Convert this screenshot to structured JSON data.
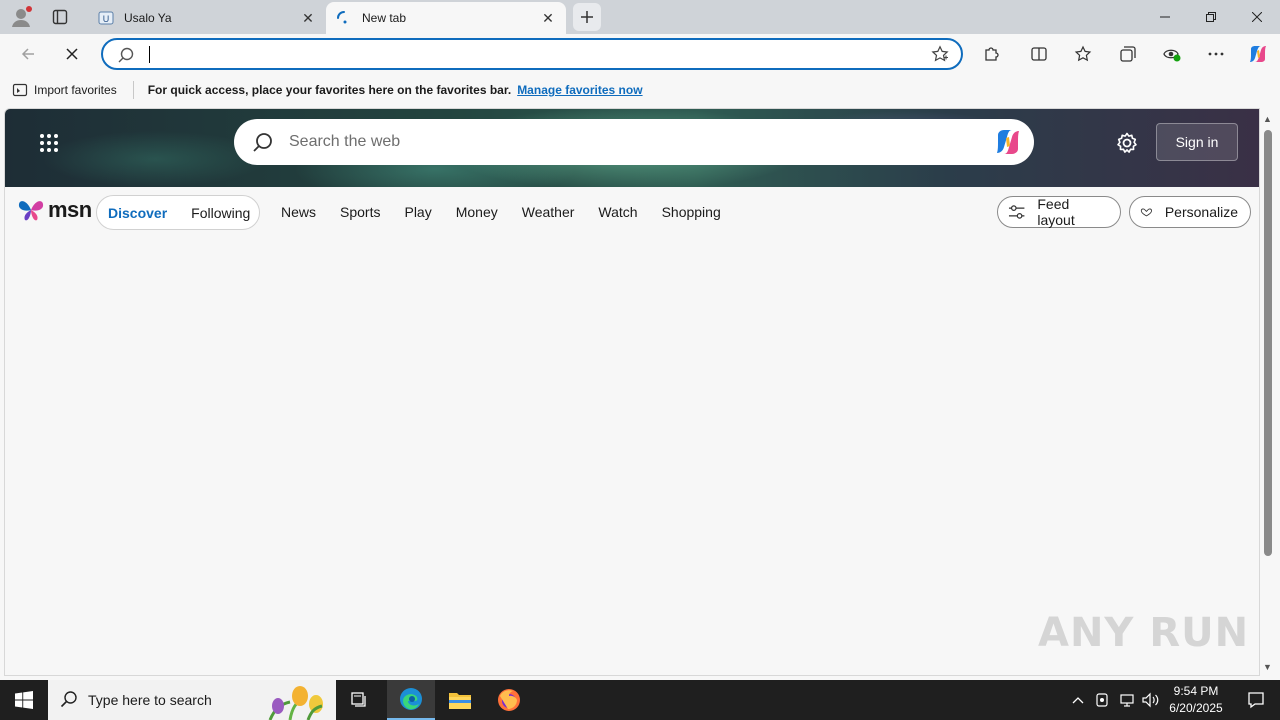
{
  "browser": {
    "tabs": [
      {
        "title": "Usalo Ya",
        "favicon": "usalo-favicon"
      },
      {
        "title": "New tab",
        "favicon": "loading-spinner-icon",
        "active": true
      }
    ],
    "omnibox": {
      "value": "",
      "placeholder": ""
    },
    "favorites_bar": {
      "import_label": "Import favorites",
      "message": "For quick access, place your favorites here on the favorites bar.",
      "manage_link": "Manage favorites now"
    },
    "accent": "#0f6cbd"
  },
  "msn": {
    "search_placeholder": "Search the web",
    "sign_in": "Sign in",
    "logo_text": "msn",
    "feed_tabs": {
      "discover": "Discover",
      "following": "Following"
    },
    "nav_links": [
      "News",
      "Sports",
      "Play",
      "Money",
      "Weather",
      "Watch",
      "Shopping"
    ],
    "feed_layout": "Feed layout",
    "personalize": "Personalize"
  },
  "watermark": "ANY RUN",
  "taskbar": {
    "search_placeholder": "Type here to search",
    "time": "9:54 PM",
    "date": "6/20/2025"
  }
}
